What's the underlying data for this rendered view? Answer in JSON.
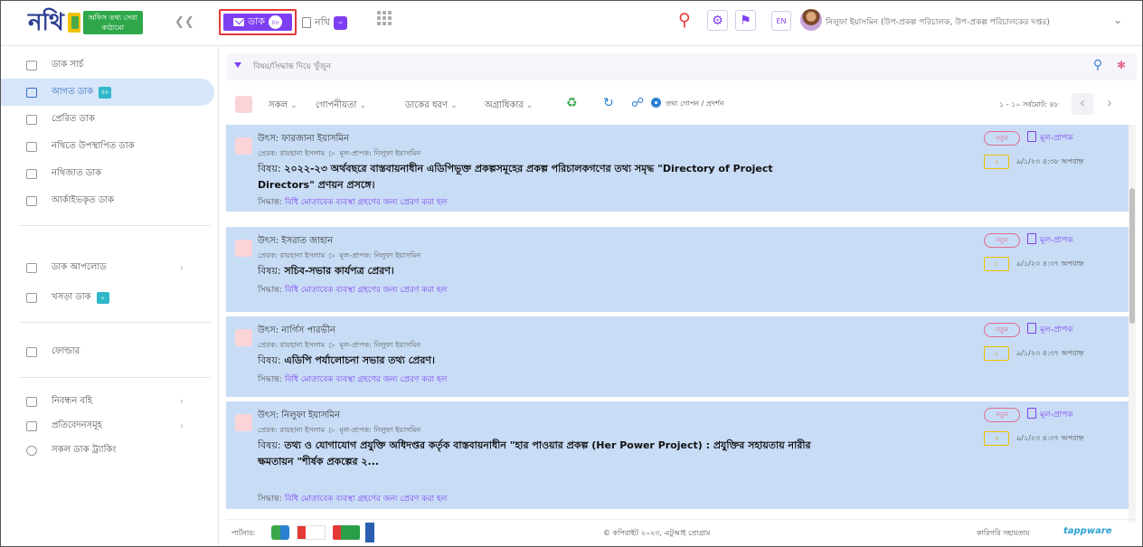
{
  "header": {
    "logo_text": "নথি",
    "logo_badge": "অফিস তথ্য সেবা কাঠামো",
    "collapse_icon": "chevron-left-icon",
    "tab_dak_label": "ডাক",
    "tab_dak_count": "৪৮",
    "tab_nothi_label": "নথি",
    "tab_nothi_count": "০",
    "language": "EN",
    "user_name": "নিলুফা ইয়াসমিন (উপ-প্রকল্প পরিচালক, উপ-প্রকল্প পরিচালকের দপ্তর)",
    "accent_color": "#7e3ff2",
    "highlight_color": "#e53935"
  },
  "sidebar": {
    "items": [
      {
        "label": "ডাক সার্চ",
        "icon": "search-box-icon"
      },
      {
        "label": "আগত ডাক",
        "icon": "inbox-icon",
        "badge": "৪৮",
        "active": true
      },
      {
        "label": "প্রেরিত ডাক",
        "icon": "upload-icon"
      },
      {
        "label": "নথিতে উপস্থাপিত ডাক",
        "icon": "tray-icon"
      },
      {
        "label": "নথিজাত ডাক",
        "icon": "folder-icon"
      },
      {
        "label": "আর্কাইভকৃত ডাক",
        "icon": "archive-icon"
      },
      {
        "label": "ডাক আপলোড",
        "icon": "cloud-upload-icon"
      },
      {
        "label": "খসড়া ডাক",
        "icon": "draft-icon",
        "badge": "০"
      },
      {
        "label": "ফোল্ডার",
        "icon": "folder-icon"
      },
      {
        "label": "নিবন্ধন বহি",
        "icon": "register-icon"
      },
      {
        "label": "প্রতিবেদনসমূহ",
        "icon": "report-icon"
      },
      {
        "label": "সকল ডাক ট্র্যাকিং",
        "icon": "search-icon"
      }
    ]
  },
  "search": {
    "placeholder": "বিষয়/সিদ্ধান্ত দিয়ে খুঁজুন"
  },
  "filters": {
    "all": "সকল",
    "confidentiality": "গোপনীয়তা",
    "dak_type": "ডাকের ধরণ",
    "priority": "অগ্রাধিকার",
    "hide_show": "তথ্য গোপন / প্রদর্শন",
    "pagination": "১ - ১০ সর্বমোট: ৪৮"
  },
  "dak_list": [
    {
      "source": "উৎস: ফারজানা ইয়াসমিন",
      "sender": "প্রেরক: রায়হানা ইসলাম",
      "receiver": "মূল-প্রাপক: নিলুফা ইয়াসমিন",
      "subject_label": "বিষয়:",
      "subject": "২০২২-২৩ অর্থবছরে বাস্তবায়নাধীন এডিপিভূক্ত প্রকল্পসমূহের প্রকল্প পরিচালকগণের তথ্য সমৃদ্ধ \"Directory of Project Directors\" প্রণয়ন প্রসঙ্গে।",
      "decision_label": "সিদ্ধান্ত:",
      "decision": "বিধি মোতাবেক ব্যবস্থা গ্রহণের জন্য প্রেরণ করা হল",
      "tag_new": "নতুন",
      "tag_type": "মূল-প্রাপক",
      "count": "২",
      "date": "৯/১/২৩ ৪:৩৮ অপরাহ্ন"
    },
    {
      "source": "উৎস: ইসরাত জাহান",
      "sender": "প্রেরক: রায়হানা ইসলাম",
      "receiver": "মূল-প্রাপক: নিলুফা ইয়াসমিন",
      "subject_label": "বিষয়:",
      "subject": "সচিব-সভার কার্যপত্র প্রেরণ।",
      "decision_label": "সিদ্ধান্ত:",
      "decision": "বিধি মোতাবেক ব্যবস্থা গ্রহণের জন্য প্রেরণ করা হল",
      "tag_new": "নতুন",
      "tag_type": "মূল-প্রাপক",
      "count": "১",
      "date": "৯/১/২৩ ৪:৩৭ অপরাহ্ন"
    },
    {
      "source": "উৎস: নার্গিস পারভীন",
      "sender": "প্রেরক: রায়হানা ইসলাম",
      "receiver": "মূল-প্রাপক: নিলুফা ইয়াসমিন",
      "subject_label": "বিষয়:",
      "subject": "এডিপি পর্যালোচনা সভার তথ্য প্রেরণ।",
      "decision_label": "সিদ্ধান্ত:",
      "decision": "বিধি মোতাবেক ব্যবস্থা গ্রহণের জন্য প্রেরণ করা হল",
      "tag_new": "নতুন",
      "tag_type": "মূল-প্রাপক",
      "count": "১",
      "date": "৯/১/২৩ ৪:৩৭ অপরাহ্ন"
    },
    {
      "source": "উৎস: নিলুফা ইয়াসমিন",
      "sender": "প্রেরক: রায়হানা ইসলাম",
      "receiver": "মূল-প্রাপক: নিলুফা ইয়াসমিন",
      "subject_label": "বিষয়:",
      "subject": "তথ্য ও যোগাযোগ প্রযুক্তি অধিদপ্তর কর্তৃক বাস্তবায়নাধীন \"হার পাওয়ার প্রকল্প (Her Power Project) : প্রযুক্তির সহায়তায় নারীর ক্ষমতায়ন \"শীর্ষক প্রকল্পের ২...",
      "decision_label": "সিদ্ধান্ত:",
      "decision": "বিধি মোতাবেক ব্যবস্থা গ্রহণের জন্য প্রেরণ করা হল",
      "tag_new": "নতুন",
      "tag_type": "মূল-প্রাপক",
      "count": "৩",
      "date": "৯/১/২৩ ৪:৩৭ অপরাহ্ন"
    }
  ],
  "footer": {
    "partner_label": "পার্টনার:",
    "copyright": "© কপিরাইট ২০২৩, এটুআই প্রোগ্রাম",
    "tech_label": "কারিগরি সহায়তায়",
    "tech_logo": "tappware"
  }
}
